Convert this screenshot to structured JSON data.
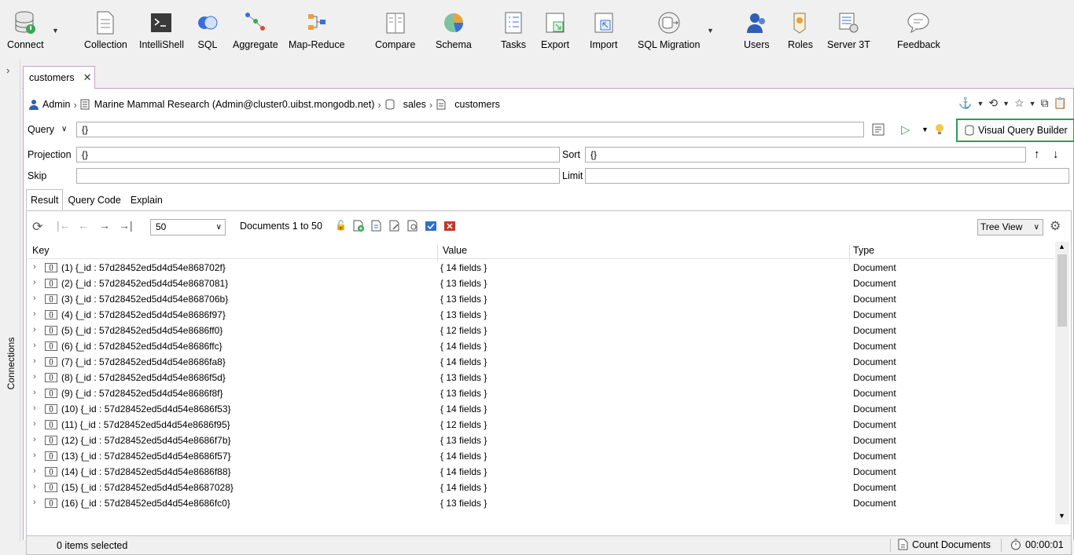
{
  "toolbar": {
    "items": [
      {
        "label": "Connect",
        "icon": "connect-icon"
      },
      {
        "label": "Collection",
        "icon": "collection-icon"
      },
      {
        "label": "IntelliShell",
        "icon": "intellishell-icon"
      },
      {
        "label": "SQL",
        "icon": "sql-icon"
      },
      {
        "label": "Aggregate",
        "icon": "aggregate-icon"
      },
      {
        "label": "Map-Reduce",
        "icon": "map-reduce-icon"
      },
      {
        "label": "Compare",
        "icon": "compare-icon"
      },
      {
        "label": "Schema",
        "icon": "schema-icon"
      },
      {
        "label": "Tasks",
        "icon": "tasks-icon"
      },
      {
        "label": "Export",
        "icon": "export-icon"
      },
      {
        "label": "Import",
        "icon": "import-icon"
      },
      {
        "label": "SQL Migration",
        "icon": "sql-migration-icon"
      },
      {
        "label": "Users",
        "icon": "users-icon"
      },
      {
        "label": "Roles",
        "icon": "roles-icon"
      },
      {
        "label": "Server 3T",
        "icon": "server-3t-icon"
      },
      {
        "label": "Feedback",
        "icon": "feedback-icon"
      }
    ]
  },
  "sidebar": {
    "label": "Connections"
  },
  "tab": {
    "label": "customers"
  },
  "breadcrumb": {
    "user": "Admin",
    "connection": "Marine Mammal Research (Admin@cluster0.uibst.mongodb.net)",
    "database": "sales",
    "collection": "customers"
  },
  "query": {
    "query_label": "Query",
    "query_value": "{}",
    "projection_label": "Projection",
    "projection_value": "{}",
    "sort_label": "Sort",
    "sort_value": "{}",
    "skip_label": "Skip",
    "skip_value": "",
    "limit_label": "Limit",
    "limit_value": "",
    "vqb_label": "Visual Query Builder"
  },
  "result_tabs": [
    "Result",
    "Query Code",
    "Explain"
  ],
  "result_toolbar": {
    "page_size": "50",
    "documents_text": "Documents 1 to 50",
    "view_mode": "Tree View"
  },
  "grid": {
    "columns": [
      "Key",
      "Value",
      "Type"
    ],
    "rows": [
      {
        "key": "(1) {_id : 57d28452ed5d4d54e868702f}",
        "value": "{ 14 fields }",
        "type": "Document"
      },
      {
        "key": "(2) {_id : 57d28452ed5d4d54e8687081}",
        "value": "{ 13 fields }",
        "type": "Document"
      },
      {
        "key": "(3) {_id : 57d28452ed5d4d54e868706b}",
        "value": "{ 13 fields }",
        "type": "Document"
      },
      {
        "key": "(4) {_id : 57d28452ed5d4d54e8686f97}",
        "value": "{ 13 fields }",
        "type": "Document"
      },
      {
        "key": "(5) {_id : 57d28452ed5d4d54e8686ff0}",
        "value": "{ 12 fields }",
        "type": "Document"
      },
      {
        "key": "(6) {_id : 57d28452ed5d4d54e8686ffc}",
        "value": "{ 14 fields }",
        "type": "Document"
      },
      {
        "key": "(7) {_id : 57d28452ed5d4d54e8686fa8}",
        "value": "{ 14 fields }",
        "type": "Document"
      },
      {
        "key": "(8) {_id : 57d28452ed5d4d54e8686f5d}",
        "value": "{ 13 fields }",
        "type": "Document"
      },
      {
        "key": "(9) {_id : 57d28452ed5d4d54e8686f8f}",
        "value": "{ 13 fields }",
        "type": "Document"
      },
      {
        "key": "(10) {_id : 57d28452ed5d4d54e8686f53}",
        "value": "{ 14 fields }",
        "type": "Document"
      },
      {
        "key": "(11) {_id : 57d28452ed5d4d54e8686f95}",
        "value": "{ 12 fields }",
        "type": "Document"
      },
      {
        "key": "(12) {_id : 57d28452ed5d4d54e8686f7b}",
        "value": "{ 13 fields }",
        "type": "Document"
      },
      {
        "key": "(13) {_id : 57d28452ed5d4d54e8686f57}",
        "value": "{ 14 fields }",
        "type": "Document"
      },
      {
        "key": "(14) {_id : 57d28452ed5d4d54e8686f88}",
        "value": "{ 14 fields }",
        "type": "Document"
      },
      {
        "key": "(15) {_id : 57d28452ed5d4d54e8687028}",
        "value": "{ 14 fields }",
        "type": "Document"
      },
      {
        "key": "(16) {_id : 57d28452ed5d4d54e8686fc0}",
        "value": "{ 13 fields }",
        "type": "Document"
      }
    ]
  },
  "status": {
    "selected": "0 items selected",
    "count_label": "Count Documents",
    "timer": "00:00:01"
  }
}
